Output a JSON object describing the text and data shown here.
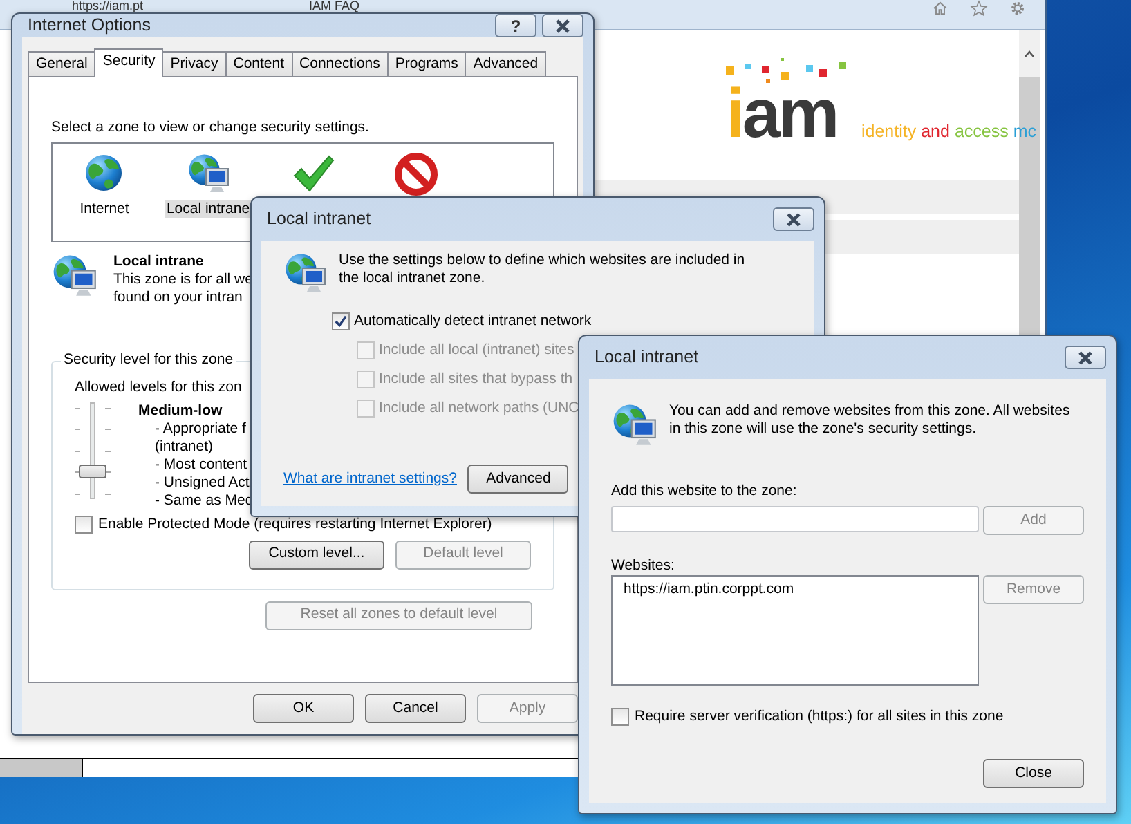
{
  "browser": {
    "tabs": [
      {
        "title": "https://iam.pt"
      },
      {
        "title": "IAM FAQ"
      }
    ],
    "logo": {
      "wordmark": [
        {
          "text": "i",
          "color": "#f5b21c"
        },
        {
          "text": "am",
          "color": "#3a3a3a"
        }
      ],
      "tagline": [
        {
          "text": "identity",
          "color": "#f5b324"
        },
        {
          "text": "and",
          "color": "#e0262f"
        },
        {
          "text": "access",
          "color": "#86c440"
        },
        {
          "text": "mc",
          "color": "#2a9fd6"
        }
      ]
    }
  },
  "internet_options": {
    "title": "Internet Options",
    "help_button": "?",
    "tabs": [
      {
        "label": "General",
        "selected": false
      },
      {
        "label": "Security",
        "selected": true
      },
      {
        "label": "Privacy",
        "selected": false
      },
      {
        "label": "Content",
        "selected": false
      },
      {
        "label": "Connections",
        "selected": false
      },
      {
        "label": "Programs",
        "selected": false
      },
      {
        "label": "Advanced",
        "selected": false
      }
    ],
    "zone_prompt": "Select a zone to view or change security settings.",
    "zones": [
      {
        "kind": "internet",
        "label": "Internet",
        "selected": false
      },
      {
        "kind": "intranet",
        "label": "Local intrane",
        "selected": true
      },
      {
        "kind": "trusted",
        "selected": false
      },
      {
        "kind": "restricted",
        "selected": false
      }
    ],
    "zone_title": "Local intrane",
    "zone_description": [
      "This zone is for all we",
      "found on your intran"
    ],
    "level_group": "Security level for this zone",
    "allowed_levels": "Allowed levels for this zon",
    "level_name": "Medium-low",
    "level": 0.25,
    "level_details": [
      "- Appropriate f",
      "(intranet)",
      "- Most content",
      "- Unsigned Act",
      "- Same as Med"
    ],
    "protected_mode": {
      "label": "Enable Protected Mode (requires restarting Internet Explorer)",
      "checked": false
    },
    "level_buttons": [
      {
        "label": "Custom level...",
        "disabled": false
      },
      {
        "label": "Default level",
        "disabled": true
      }
    ],
    "reset_button": {
      "label": "Reset all zones to default level",
      "disabled": true
    },
    "footer_buttons": [
      {
        "label": "OK",
        "disabled": false
      },
      {
        "label": "Cancel",
        "disabled": false
      },
      {
        "label": "Apply",
        "disabled": true
      }
    ]
  },
  "intranet_dialog": {
    "title": "Local intranet",
    "description": "Use the settings below to define which websites are included in the local intranet zone.",
    "options": [
      {
        "label": "Automatically detect intranet network",
        "checked": true,
        "disabled": false
      },
      {
        "label": "Include all local (intranet) sites",
        "checked": false,
        "disabled": true
      },
      {
        "label": "Include all sites that bypass th",
        "checked": false,
        "disabled": true
      },
      {
        "label": "Include all network paths (UNC",
        "checked": false,
        "disabled": true
      }
    ],
    "link": "What are intranet settings?",
    "button": "Advanced"
  },
  "sites_dialog": {
    "title": "Local intranet",
    "description": "You can add and remove websites from this zone. All websites in this zone will use the zone's security settings.",
    "add_label": "Add this website to the zone:",
    "add_button": {
      "label": "Add",
      "disabled": true
    },
    "websites_label": "Websites:",
    "websites": [
      {
        "text": "https://iam.ptin.corppt.com",
        "selected": false
      }
    ],
    "remove_button": {
      "label": "Remove",
      "disabled": true
    },
    "require_https": {
      "label": "Require server verification (https:) for all sites in this zone",
      "checked": false
    },
    "close_button": "Close"
  }
}
